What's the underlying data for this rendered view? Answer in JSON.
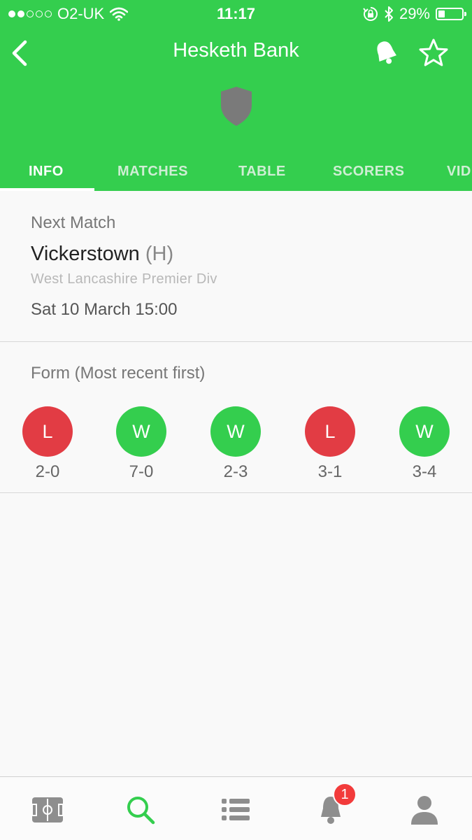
{
  "status_bar": {
    "carrier": "O2-UK",
    "time": "11:17",
    "battery": "29%",
    "battery_level": 0.29
  },
  "header": {
    "title": "Hesketh Bank"
  },
  "tabs": [
    {
      "label": "INFO",
      "active": true
    },
    {
      "label": "MATCHES",
      "active": false
    },
    {
      "label": "TABLE",
      "active": false
    },
    {
      "label": "SCORERS",
      "active": false
    },
    {
      "label": "VID",
      "active": false
    }
  ],
  "next_match": {
    "heading": "Next Match",
    "opponent": "Vickerstown",
    "venue": "(H)",
    "competition": "West Lancashire Premier Div",
    "datetime": "Sat 10 March 15:00"
  },
  "form": {
    "heading": "Form (Most recent first)",
    "results": [
      {
        "result": "L",
        "score": "2-0",
        "color": "#e23c44"
      },
      {
        "result": "W",
        "score": "7-0",
        "color": "#34ce4e"
      },
      {
        "result": "W",
        "score": "2-3",
        "color": "#34ce4e"
      },
      {
        "result": "L",
        "score": "3-1",
        "color": "#e23c44"
      },
      {
        "result": "W",
        "score": "3-4",
        "color": "#34ce4e"
      }
    ]
  },
  "bottom_nav": {
    "items": [
      {
        "icon": "pitch-icon"
      },
      {
        "icon": "search-icon",
        "active": true
      },
      {
        "icon": "list-icon"
      },
      {
        "icon": "bell-icon",
        "badge": "1"
      },
      {
        "icon": "profile-icon"
      }
    ]
  },
  "colors": {
    "brand_green": "#34ce4e",
    "loss_red": "#e23c44",
    "badge_red": "#f23b3b"
  }
}
